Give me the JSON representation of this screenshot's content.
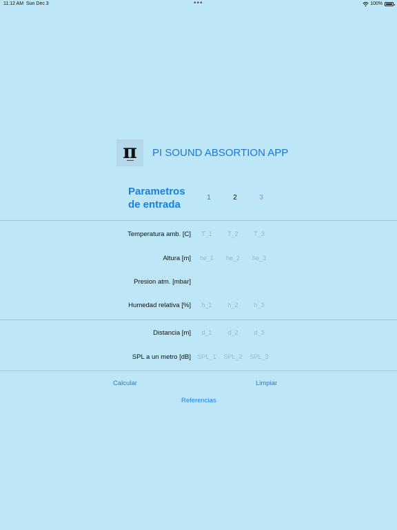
{
  "status_bar": {
    "time": "11:12 AM",
    "date": "Sun Dec 3",
    "dots": "•••",
    "battery_pct": "100%"
  },
  "header": {
    "logo_glyph": "π",
    "title": "PI SOUND ABSORTION APP"
  },
  "params": {
    "title_line1": "Parametros",
    "title_line2": "de entrada",
    "columns": [
      {
        "label": "1",
        "color": "#1b7fde"
      },
      {
        "label": "2",
        "color": "#111111"
      },
      {
        "label": "3",
        "color": "#8f8fb8"
      }
    ]
  },
  "rows": [
    {
      "label": "Temperatura amb. [C]",
      "placeholders": [
        "T_1",
        "T_2",
        "T_3"
      ]
    },
    {
      "label": "Altura [m]",
      "placeholders": [
        "he_1",
        "he_2",
        "he_3"
      ]
    },
    {
      "label": "Presion atm. [mbar]",
      "placeholders": [
        "",
        "",
        ""
      ]
    },
    {
      "label": "Humedad relativa [%]",
      "placeholders": [
        "h_1",
        "h_2",
        "h_3"
      ]
    },
    {
      "label": "Distancia [m]",
      "placeholders": [
        "d_1",
        "d_2",
        "d_3"
      ]
    },
    {
      "label": "SPL a un metro [dB]",
      "placeholders": [
        "SPL_1",
        "SPL_2",
        "SPL_3"
      ]
    }
  ],
  "actions": {
    "calcular": "Calcular",
    "limpiar": "Limpiar",
    "referencias": "Referencias"
  },
  "colors": {
    "background": "#bde6f6",
    "accent": "#1b7fde",
    "placeholder": "#97b9c9"
  }
}
